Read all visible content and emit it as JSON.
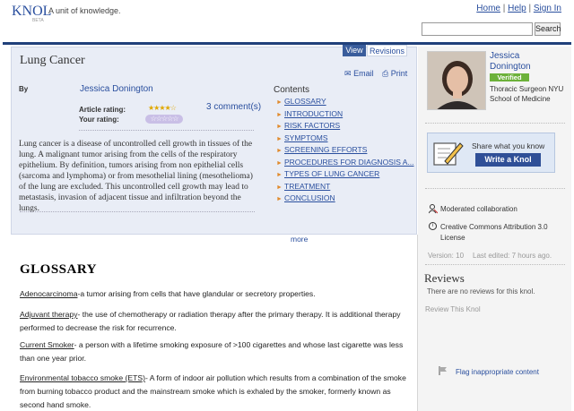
{
  "header": {
    "logo": "KNOL",
    "beta": "BETA",
    "tagline": "A unit of knowledge.",
    "links": [
      "Home",
      "Help",
      "Sign In"
    ],
    "search_placeholder": "",
    "search_button": "Search"
  },
  "tabs": {
    "view": "View",
    "revisions": "Revisions"
  },
  "article": {
    "title": "Lung Cancer",
    "email": "Email",
    "print": "Print",
    "by_label": "By",
    "author": "Jessica Donington",
    "article_rating_label": "Article rating:",
    "your_rating_label": "Your rating:",
    "article_stars": "★★★★☆",
    "your_stars": "☆☆☆☆☆",
    "article_rating_value": 4,
    "comments": "3 comment(s)",
    "summary": "Lung cancer is a disease of uncontrolled cell growth in tissues of the lung. A malignant tumor arising from the cells of the respiratory epithelium. By definition, tumors arising from non epithelial cells (sarcoma and lymphoma) or from mesothelial lining (mesothelioma) of the lung are excluded. This uncontrolled cell growth may lead to metastasis, invasion of adjacent tissue and infiltration beyond the lungs."
  },
  "contents": {
    "label": "Contents",
    "items": [
      "GLOSSARY",
      "INTRODUCTION",
      "RISK FACTORS",
      "SYMPTOMS",
      "SCREENING EFFORTS",
      "PROCEDURES FOR DIAGNOSIS A...",
      "TYPES OF LUNG CANCER",
      "TREATMENT",
      "CONCLUSION"
    ],
    "more": "more"
  },
  "glossary": {
    "title": "GLOSSARY",
    "entries": [
      {
        "term": "Adenocarcinoma",
        "def": "-a tumor arising from cells that have glandular or secretory properties."
      },
      {
        "term": "Adjuvant therapy",
        "def": "- the use of chemotherapy or radiation therapy after the primary therapy. It is additional therapy performed to decrease the risk for recurrence."
      },
      {
        "term": "Current Smoker",
        "def": "- a person with a lifetime smoking exposure of >100 cigarettes and whose last cigarette was less than one year prior."
      },
      {
        "term": "Environmental tobacco smoke (ETS)",
        "def": "- A form of indoor air pollution which results from a combination of the smoke from burning tobacco product and the mainstream smoke which is exhaled by the smoker, formerly known as second hand smoke."
      }
    ]
  },
  "sidebar": {
    "profile_name": "Jessica Donington",
    "verified": "Verified",
    "role": "Thoracic Surgeon NYU School of Medicine",
    "share_text": "Share what you know",
    "write_button": "Write a Knol",
    "collab": "Moderated collaboration",
    "license": "Creative Commons Attribution 3.0 License",
    "version": "Version: 10",
    "last_edited": "Last edited: 7 hours ago.",
    "reviews_title": "Reviews",
    "reviews_empty": "There are no reviews for this knol.",
    "review_link": "Review This Knol",
    "flag": "Flag inappropriate content"
  },
  "colors": {
    "brand": "#2a4f9e",
    "nav": "#20407a",
    "verified": "#6cb13a",
    "toc_arrow": "#e08a2c"
  }
}
